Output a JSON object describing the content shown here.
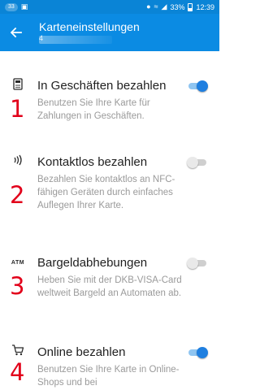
{
  "statusbar": {
    "left_badge": "33",
    "battery": "33%",
    "time": "12:39"
  },
  "appbar": {
    "title": "Karteneinstellungen",
    "subtitle_prefix": "4"
  },
  "colors": {
    "primary": "#0b8be3",
    "statusbar": "#0a84d6",
    "toggle_on": "#1f7fe0",
    "toggle_off": "#cfcfcf",
    "annotation": "#e2001a"
  },
  "settings": [
    {
      "icon": "store-card-terminal-icon",
      "title": "In Geschäften bezahlen",
      "description": "Benutzen Sie Ihre Karte für Zahlungen in Geschäften.",
      "enabled": true,
      "annotation": "1"
    },
    {
      "icon": "contactless-icon",
      "title": "Kontaktlos bezahlen",
      "description": "Bezahlen Sie kontaktlos an NFC-fähigen Geräten durch einfaches Auflegen Ihrer Karte.",
      "enabled": false,
      "annotation": "2"
    },
    {
      "icon": "atm-icon",
      "icon_text": "ATM",
      "title": "Bargeldabhebungen",
      "description": "Heben Sie mit der DKB-VISA-Card weltweit Bargeld an Automaten ab.",
      "enabled": false,
      "annotation": "3"
    },
    {
      "icon": "shopping-cart-icon",
      "title": "Online bezahlen",
      "description": "Benutzen Sie Ihre Karte in Online-Shops und bei",
      "enabled": true,
      "annotation": "4"
    }
  ]
}
